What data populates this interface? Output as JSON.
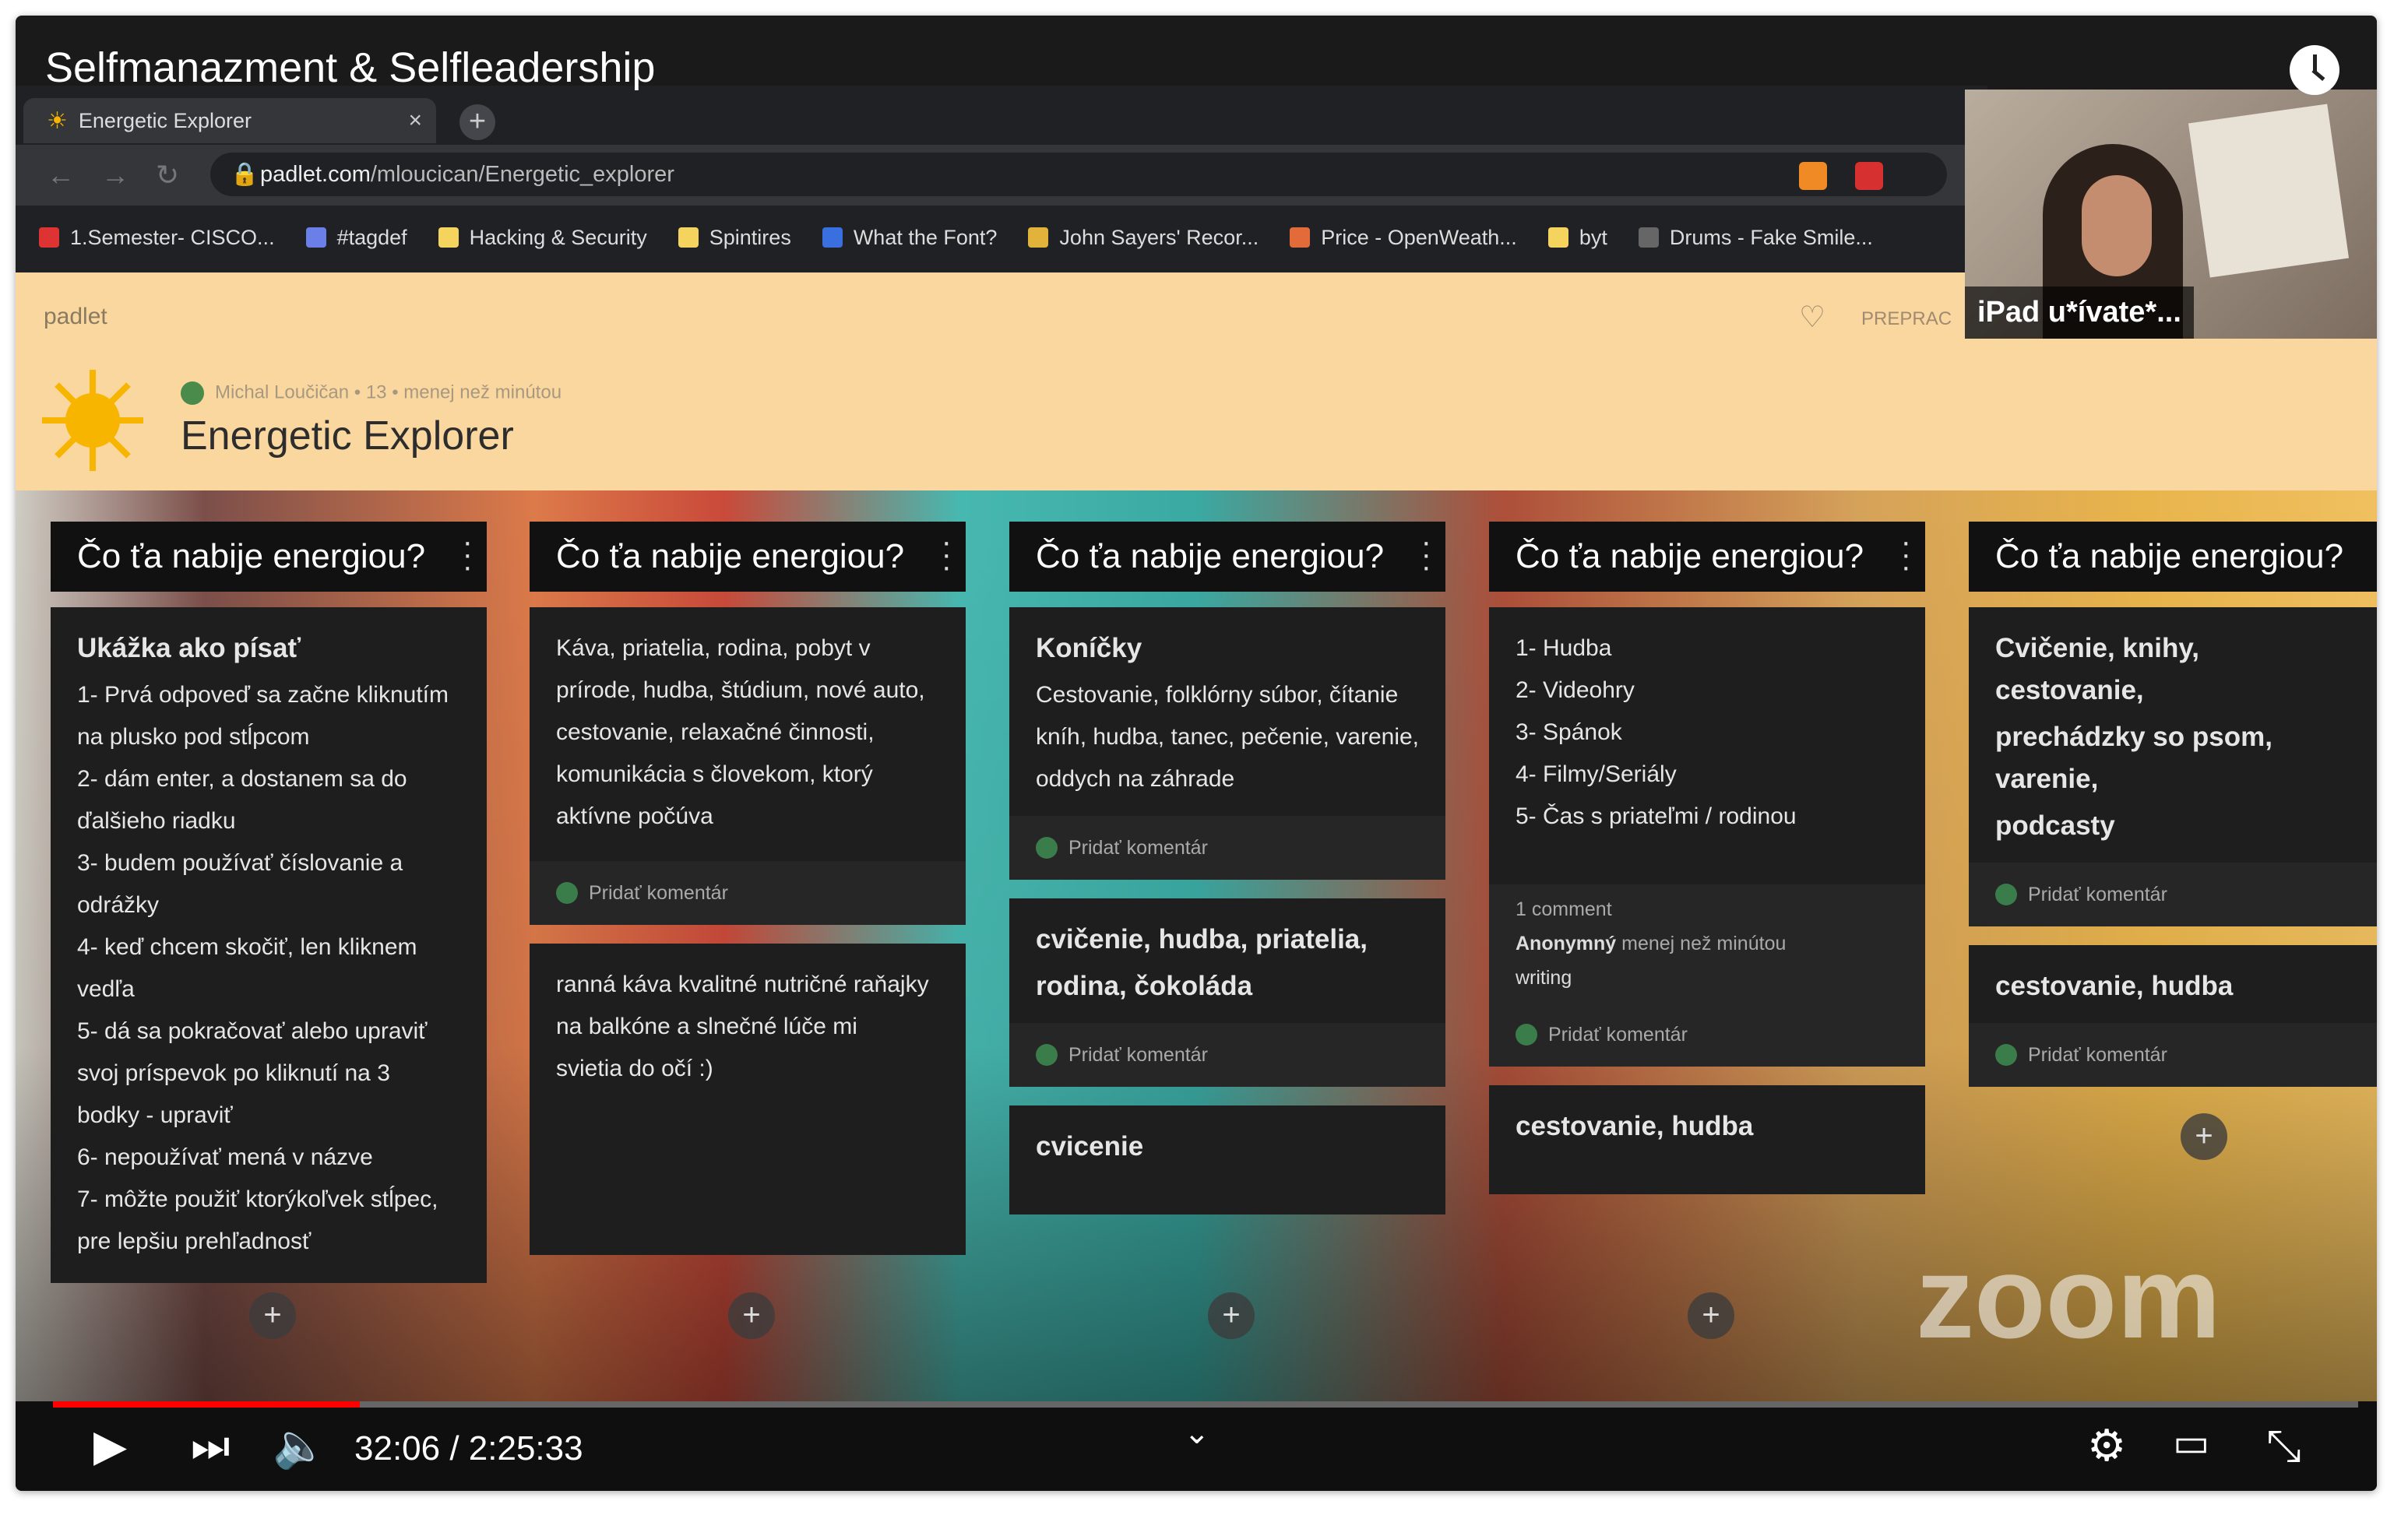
{
  "video": {
    "title": "Selfmanazment & Selfleadership",
    "current_time": "32:06 / 2:25:33",
    "progress_fraction": 0.133,
    "buffered_fraction": 0.31
  },
  "browser": {
    "tab_title": "Energetic Explorer",
    "url_host": "padlet.com",
    "url_path": "/mloucican/Energetic_explorer",
    "bookmarks": [
      "1.Semester- CISCO...",
      "#tagdef",
      "Hacking & Security",
      "Spintires",
      "What the Font?",
      "John Sayers' Recor...",
      "Price - OpenWeath...",
      "byt",
      "Drums - Fake Smile..."
    ]
  },
  "padlet": {
    "logo": "padlet",
    "prepra": "PREPRAC",
    "author_line": "Michal Loučičan  •  13  •  menej než minútou",
    "board_title": "Energetic Explorer"
  },
  "columns": [
    {
      "header": "Čo ťa nabije energiou?",
      "cards": [
        {
          "title": "Ukážka ako písať",
          "lines": [
            "1- Prvá odpoveď sa začne kliknutím",
            "na plusko pod stĺpcom",
            "2- dám enter, a dostanem sa do",
            "ďalšieho riadku",
            "3- budem používať číslovanie a",
            "odrážky",
            "4- keď chcem skočiť, len kliknem",
            "vedľa",
            "5- dá sa pokračovať alebo upraviť",
            "svoj príspevok po kliknutí na 3",
            "bodky - upraviť",
            "6-  nepoužívať mená v názve",
            "7- môžte použiť ktorýkoľvek stĺpec,",
            "pre lepšiu prehľadnosť"
          ]
        }
      ]
    },
    {
      "header": "Čo ťa nabije energiou?",
      "cards": [
        {
          "lines": [
            "Káva, priatelia, rodina, pobyt v",
            "prírode, hudba, štúdium, nové auto,",
            "cestovanie, relaxačné činnosti,",
            "komunikácia s človekom, ktorý",
            "aktívne počúva"
          ],
          "comment": "Pridať komentár"
        },
        {
          "lines": [
            "ranná káva kvalitné nutričné raňajky",
            "na balkóne a slnečné lúče mi",
            "svietia do očí :)"
          ]
        }
      ]
    },
    {
      "header": "Čo ťa nabije energiou?",
      "cards": [
        {
          "title": "Koníčky",
          "lines": [
            "Cestovanie, folklórny súbor, čítanie",
            "kníh, hudba, tanec, pečenie, varenie,",
            "oddych na záhrade"
          ],
          "comment": "Pridať komentár"
        },
        {
          "title": "cvičenie, hudba, priatelia,",
          "title2": "rodina, čokoláda",
          "comment": "Pridať komentár"
        },
        {
          "title": "cvicenie"
        }
      ]
    },
    {
      "header": "Čo ťa nabije energiou?",
      "cards": [
        {
          "lines": [
            "1- Hudba",
            "2- Videohry",
            "3- Spánok",
            "4- Filmy/Seriály",
            "5-  Čas s priateľmi / rodinou"
          ],
          "comment_count": "1 comment",
          "comment_author": "Anonymný",
          "comment_time": "menej než minútou",
          "comment_text": "writing",
          "comment": "Pridať komentár"
        },
        {
          "title": "cestovanie, hudba"
        }
      ]
    },
    {
      "header": "Čo ťa nabije energiou?",
      "cards": [
        {
          "title": "Cvičenie, knihy, cestovanie,",
          "title2": "prechádzky so psom, varenie,",
          "title3": "podcasty",
          "comment": "Pridať komentár"
        },
        {
          "title": "cestovanie, hudba",
          "comment": "Pridať komentár"
        }
      ]
    }
  ],
  "pip": {
    "label": "iPad u*ívate*..."
  },
  "watermark": "zoom",
  "icons": {
    "play": "play-icon",
    "next": "next-icon",
    "volume": "volume-icon",
    "settings": "gear-icon",
    "cast": "cast-icon",
    "exit_fullscreen": "exit-fullscreen-icon",
    "clock": "clock-icon"
  }
}
